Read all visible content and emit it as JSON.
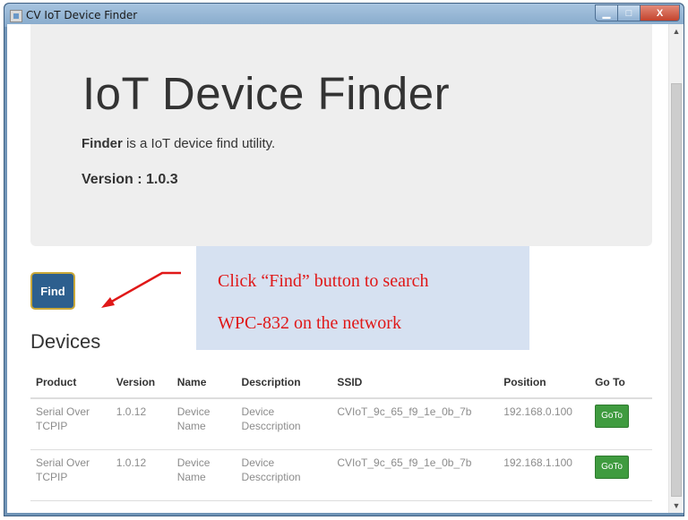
{
  "window": {
    "title": "CV IoT Device Finder",
    "minimize_glyph": "▁",
    "maximize_glyph": "□",
    "close_glyph": "X"
  },
  "jumbotron": {
    "heading": "IoT Device Finder",
    "lead_strong": "Finder",
    "lead_rest": " is a IoT device find utility.",
    "version": "Version : 1.0.3"
  },
  "find_button": {
    "label": "Find"
  },
  "devices": {
    "heading": "Devices",
    "columns": [
      "Product",
      "Version",
      "Name",
      "Description",
      "SSID",
      "Position",
      "Go To"
    ],
    "rows": [
      {
        "product": "Serial Over TCPIP",
        "version": "1.0.12",
        "name": "Device Name",
        "description": "Device Desccription",
        "ssid": "CVIoT_9c_65_f9_1e_0b_7b",
        "position": "192.168.0.100",
        "goto": "GoTo"
      },
      {
        "product": "Serial Over TCPIP",
        "version": "1.0.12",
        "name": "Device Name",
        "description": "Device Desccription",
        "ssid": "CVIoT_9c_65_f9_1e_0b_7b",
        "position": "192.168.1.100",
        "goto": "GoTo"
      }
    ]
  },
  "annotation": {
    "line1": "Click “Find” button to search",
    "line2": "WPC-832 on the network"
  },
  "colors": {
    "find_button": "#2d5f8e",
    "goto_button": "#3f9b3f",
    "annotation_text": "#e01818",
    "annotation_bg": "#d6e1f1"
  }
}
